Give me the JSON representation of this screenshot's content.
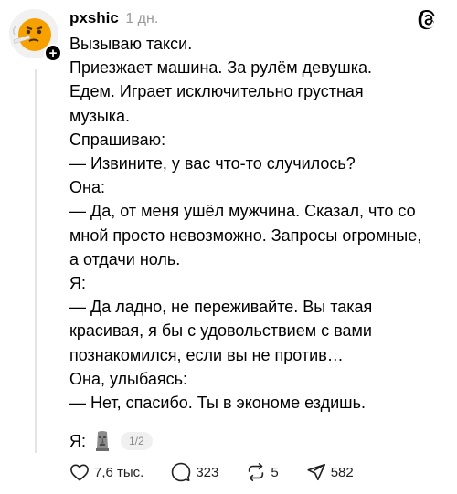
{
  "post": {
    "author": "pxshic",
    "time": "1 дн.",
    "text_lines": [
      "Вызываю такси.",
      "Приезжает машина. За рулём девушка.",
      "Едем. Играет исключительно грустная",
      "музыка.",
      "Спрашиваю:",
      "— Извините, у вас что-то случилось?",
      "Она:",
      "— Да, от меня ушёл мужчина. Сказал, что со",
      "мной просто невозможно. Запросы огромные,",
      "а отдачи ноль.",
      "Я:",
      "— Да ладно, не переживайте. Вы такая",
      "красивая, я бы с удовольствием с вами",
      "познакомился, если вы не против…",
      "Она, улыбаясь:",
      "— Нет, спасибо. Ты в экономе ездишь."
    ],
    "last_line": "Я:",
    "last_line_icon": "moai-emoji-icon",
    "page_indicator": "1/2"
  },
  "actions": {
    "likes": "7,6 тыс.",
    "comments": "323",
    "reposts": "5",
    "shares": "582"
  },
  "icons": [
    "avatar",
    "plus-icon",
    "threads-logo-icon",
    "heart-icon",
    "comment-icon",
    "repost-icon",
    "share-icon"
  ]
}
